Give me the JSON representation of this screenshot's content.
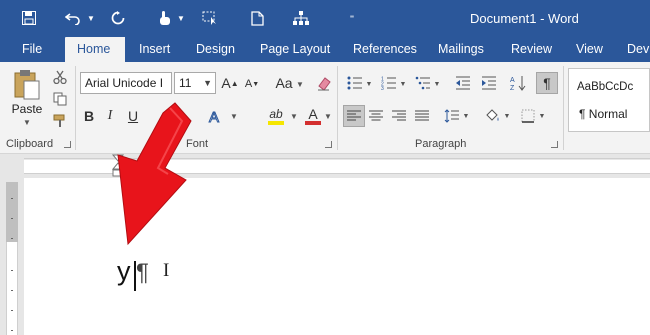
{
  "window": {
    "title": "Document1 - Word"
  },
  "tabs": [
    {
      "label": "File"
    },
    {
      "label": "Home"
    },
    {
      "label": "Insert"
    },
    {
      "label": "Design"
    },
    {
      "label": "Page Layout"
    },
    {
      "label": "References"
    },
    {
      "label": "Mailings"
    },
    {
      "label": "Review"
    },
    {
      "label": "View"
    },
    {
      "label": "Dev"
    }
  ],
  "clipboard": {
    "paste_label": "Paste",
    "group_label": "Clipboard"
  },
  "font": {
    "name_value": "Arial Unicode I",
    "size_value": "11",
    "group_label": "Font",
    "bold": "B",
    "italic": "I",
    "underline": "U",
    "grow": "A",
    "shrink": "A",
    "case": "Aa",
    "highlight": "ab",
    "color": "A"
  },
  "paragraph": {
    "group_label": "Paragraph",
    "pilcrow": "¶"
  },
  "styles": {
    "sample": "AaBbCcDc",
    "normal_label": "¶ Normal"
  },
  "document": {
    "text": "y",
    "pilcrow": "¶",
    "cursor": "I"
  },
  "colors": {
    "accent": "#2b579a",
    "arrow": "#e8141b",
    "highlight": "#f5e600",
    "font_color": "#d32f2f"
  }
}
